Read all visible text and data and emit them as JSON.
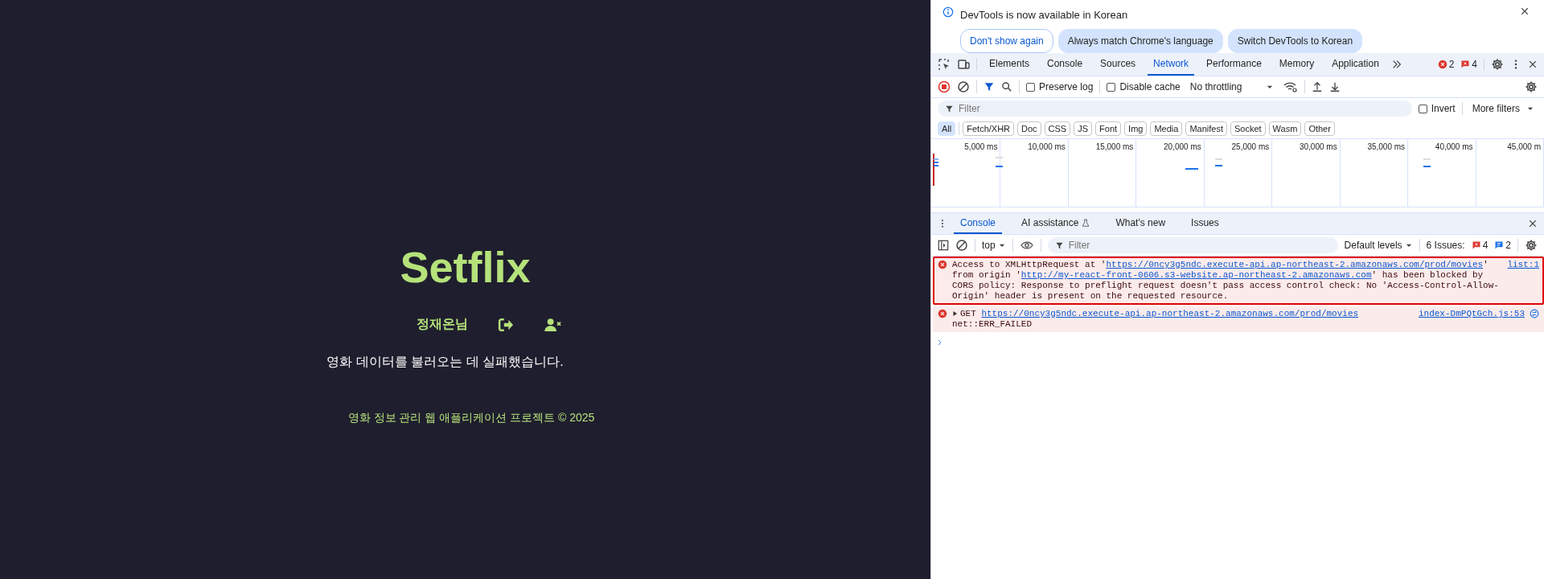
{
  "page": {
    "logo": "Setflix",
    "user_name": "정재온님",
    "message": "영화 데이터를 불러오는 데 실패했습니다.",
    "footer": "영화 정보 관리 웹 애플리케이션 프로젝트 © 2025"
  },
  "devtools": {
    "infobar": {
      "text": "DevTools is now available in Korean",
      "buttons": [
        {
          "label": "Don't show again",
          "kind": "outlined"
        },
        {
          "label": "Always match Chrome's language",
          "kind": "filled"
        },
        {
          "label": "Switch DevTools to Korean",
          "kind": "filled"
        }
      ]
    },
    "tabs": [
      {
        "label": "Elements",
        "selected": false
      },
      {
        "label": "Console",
        "selected": false
      },
      {
        "label": "Sources",
        "selected": false
      },
      {
        "label": "Network",
        "selected": true
      },
      {
        "label": "Performance",
        "selected": false
      },
      {
        "label": "Memory",
        "selected": false
      },
      {
        "label": "Application",
        "selected": false
      }
    ],
    "error_count": "2",
    "issue_count": "4",
    "network_toolbar": {
      "recording": true,
      "preserve_log": {
        "label": "Preserve log",
        "checked": false
      },
      "disable_cache": {
        "label": "Disable cache",
        "checked": false
      },
      "throttling": "No throttling"
    },
    "filter_bar": {
      "placeholder": "Filter",
      "invert": {
        "label": "Invert",
        "checked": false
      },
      "more_filters": "More filters"
    },
    "type_filters": [
      {
        "label": "All",
        "selected": true
      },
      {
        "label": "Fetch/XHR",
        "selected": false
      },
      {
        "label": "Doc",
        "selected": false
      },
      {
        "label": "CSS",
        "selected": false
      },
      {
        "label": "JS",
        "selected": false
      },
      {
        "label": "Font",
        "selected": false
      },
      {
        "label": "Img",
        "selected": false
      },
      {
        "label": "Media",
        "selected": false
      },
      {
        "label": "Manifest",
        "selected": false
      },
      {
        "label": "Socket",
        "selected": false
      },
      {
        "label": "Wasm",
        "selected": false
      },
      {
        "label": "Other",
        "selected": false
      }
    ],
    "timeline_ticks": [
      "5,000 ms",
      "10,000 ms",
      "15,000 ms",
      "20,000 ms",
      "25,000 ms",
      "30,000 ms",
      "35,000 ms",
      "40,000 ms",
      "45,000 m"
    ],
    "drawer_tabs": [
      {
        "label": "Console",
        "selected": true
      },
      {
        "label": "AI assistance",
        "selected": false
      },
      {
        "label": "What's new",
        "selected": false
      },
      {
        "label": "Issues",
        "selected": false
      }
    ],
    "console_toolbar": {
      "context": "top",
      "placeholder": "Filter",
      "levels": "Default levels",
      "issues_label": "6 Issues:",
      "issue_errors": "4",
      "issue_info": "2"
    },
    "messages": [
      {
        "kind": "error",
        "highlighted": true,
        "expandable": false,
        "source": "list:1",
        "segments": [
          {
            "kind": "text",
            "text": "Access to XMLHttpRequest at '"
          },
          {
            "kind": "link",
            "text": "https://0ncy3g5ndc.execute-api.ap-northeast-2.amazonaws.com/prod/movies"
          },
          {
            "kind": "text",
            "text": "' from origin '"
          },
          {
            "kind": "link",
            "text": "http://my-react-front-0606.s3-website.ap-northeast-2.amazonaws.com"
          },
          {
            "kind": "text",
            "text": "' has been blocked by CORS policy: Response to preflight request doesn't pass access control check: No 'Access-Control-Allow-Origin' header is present on the requested resource."
          }
        ]
      },
      {
        "kind": "error",
        "highlighted": false,
        "expandable": true,
        "source": "index-DmPQtGch.js:53",
        "segments": [
          {
            "kind": "text",
            "text": "GET "
          },
          {
            "kind": "link",
            "text": "https://0ncy3g5ndc.execute-api.ap-northeast-2.amazonaws.com/prod/movies"
          },
          {
            "kind": "break"
          },
          {
            "kind": "text",
            "text": "net::ERR_FAILED"
          }
        ]
      }
    ]
  }
}
